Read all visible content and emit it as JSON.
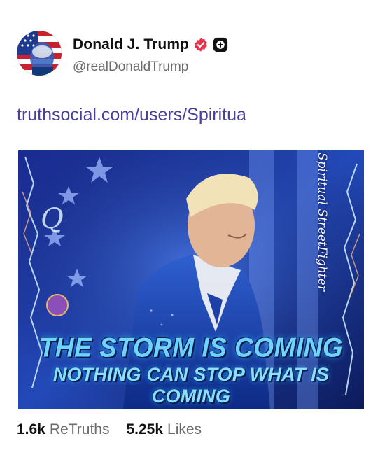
{
  "author": {
    "display_name": "Donald J. Trump",
    "handle": "@realDonaldTrump",
    "avatar_icon": "avatar-flag-portrait",
    "verified_icon": "verified-badge-icon",
    "plus_icon": "plus-badge-icon",
    "verified_color": "#e8344f"
  },
  "post": {
    "link_text": "truthsocial.com/users/Spiritua",
    "link_color": "#4a3fa0",
    "media": {
      "headline": "THE STORM IS COMING",
      "subline": "NOTHING CAN STOP WHAT IS COMING",
      "signature": "Spiritual StreetFighter"
    }
  },
  "stats": {
    "retruths_count": "1.6k",
    "retruths_label": "ReTruths",
    "likes_count": "5.25k",
    "likes_label": "Likes"
  }
}
